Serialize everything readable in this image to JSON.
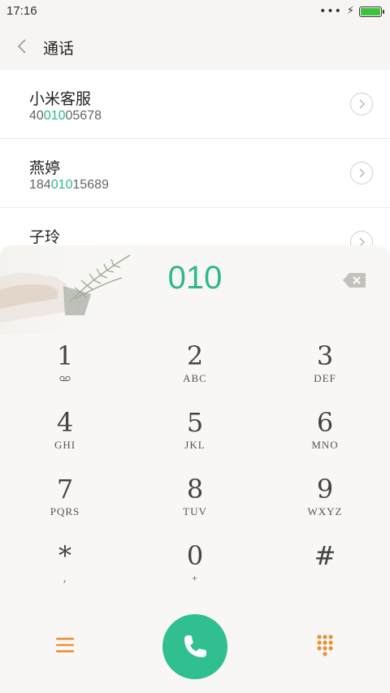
{
  "status_bar": {
    "time": "17:16",
    "more_indicator": "•••",
    "battery_level": 1.0,
    "battery_color": "#3cc23c"
  },
  "header": {
    "title": "通话",
    "back_icon": "chevron-left-icon"
  },
  "results": [
    {
      "name": "小米客服",
      "number_before": "40",
      "number_match": "010",
      "number_after": "05678"
    },
    {
      "name": "燕婷",
      "number_before": "184",
      "number_match": "010",
      "number_after": "15689"
    },
    {
      "name": "子玲",
      "number_before": "",
      "number_match": "",
      "number_after": ""
    }
  ],
  "dialpad": {
    "dialed_number": "010",
    "accent_color": "#2fb890",
    "keys": [
      {
        "digit": "1",
        "letters": ""
      },
      {
        "digit": "2",
        "letters": "ABC"
      },
      {
        "digit": "3",
        "letters": "DEF"
      },
      {
        "digit": "4",
        "letters": "GHI"
      },
      {
        "digit": "5",
        "letters": "JKL"
      },
      {
        "digit": "6",
        "letters": "MNO"
      },
      {
        "digit": "7",
        "letters": "PQRS"
      },
      {
        "digit": "8",
        "letters": "TUV"
      },
      {
        "digit": "9",
        "letters": "WXYZ"
      },
      {
        "digit": "*",
        "letters": ","
      },
      {
        "digit": "0",
        "letters": "+"
      },
      {
        "digit": "#",
        "letters": ""
      }
    ]
  },
  "actions": {
    "menu_icon": "menu-icon",
    "call_icon": "phone-icon",
    "keypad_icon": "dialpad-icon",
    "action_color": "#e8923a",
    "call_color": "#2fbf90"
  }
}
